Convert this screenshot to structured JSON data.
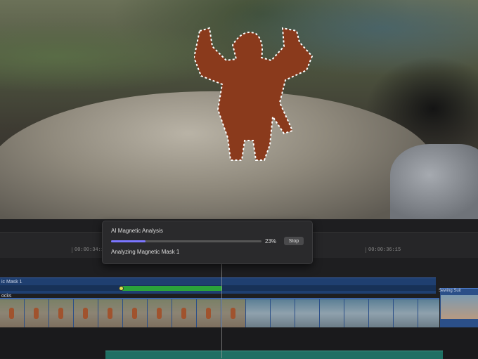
{
  "dialog": {
    "title": "AI Magnetic Analysis",
    "progress_percent": 23,
    "progress_label": "23%",
    "stop_label": "Stop",
    "status": "Analyzing Magnetic Mask 1"
  },
  "ruler": {
    "timecodes": [
      "00:00:34:1",
      "00:00:36:15"
    ]
  },
  "timeline": {
    "mask_track_label": "ic Mask 1",
    "clip_label": "ocks",
    "next_clip_label": "Sewing Suit"
  },
  "colors": {
    "progress_fill": "#7b76ff",
    "mask_segment": "#2ba33a",
    "clip_blue": "#2b4f88"
  }
}
